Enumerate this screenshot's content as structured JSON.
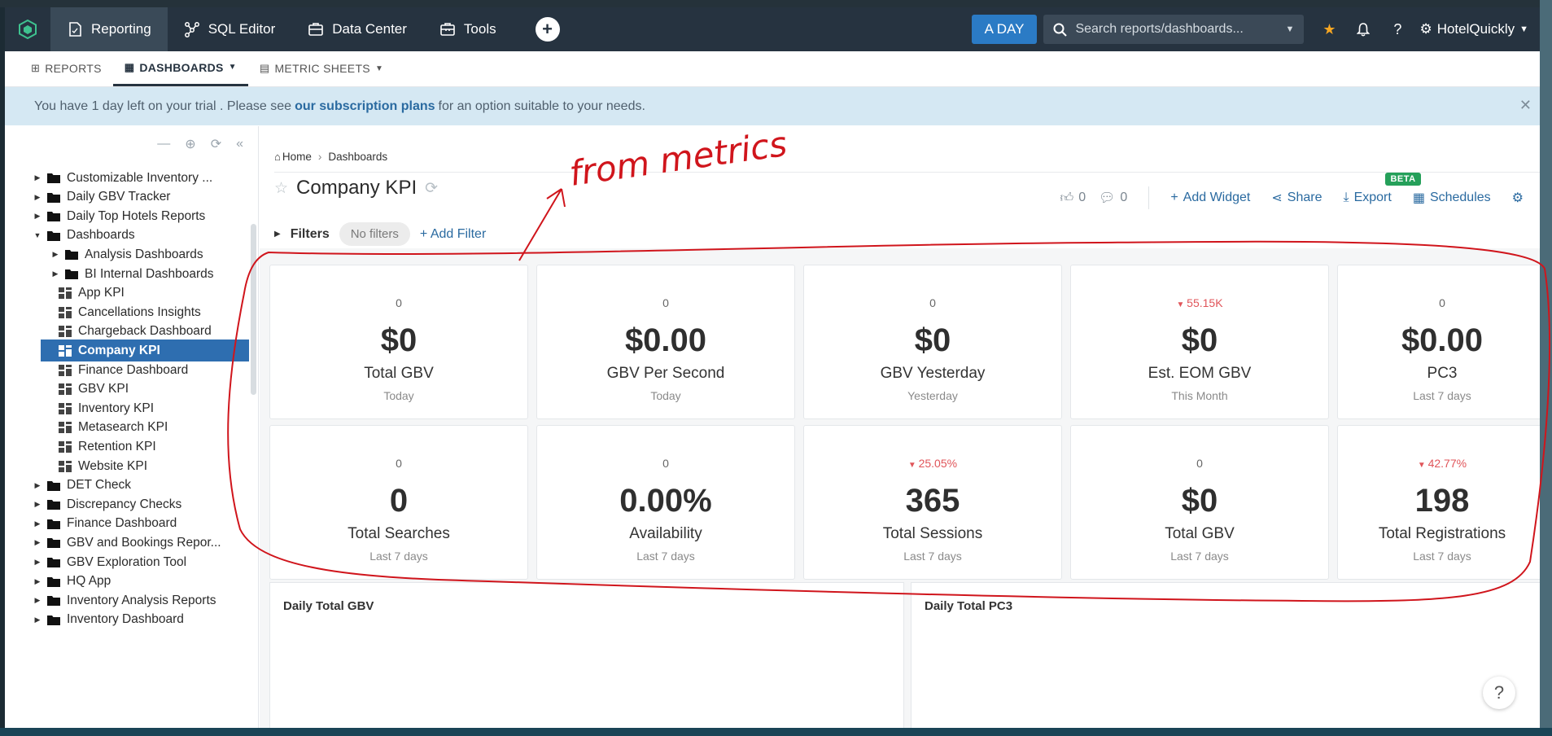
{
  "navbar": {
    "items": [
      {
        "label": "Reporting"
      },
      {
        "label": "SQL Editor"
      },
      {
        "label": "Data Center"
      },
      {
        "label": "Tools"
      }
    ],
    "trial_badge": "A DAY",
    "search_placeholder": "Search reports/dashboards...",
    "user": "HotelQuickly"
  },
  "subnav": {
    "tabs": [
      {
        "label": "REPORTS"
      },
      {
        "label": "DASHBOARDS"
      },
      {
        "label": "METRIC SHEETS"
      }
    ]
  },
  "banner": {
    "prefix": "You have 1 day left on your trial . Please see",
    "link": "our subscription plans",
    "suffix": "for an option suitable to your needs."
  },
  "sidebar": {
    "items": [
      {
        "label": "Customizable Inventory ..."
      },
      {
        "label": "Daily GBV Tracker"
      },
      {
        "label": "Daily Top Hotels Reports"
      },
      {
        "label": "Dashboards"
      },
      {
        "label": "Analysis Dashboards"
      },
      {
        "label": "BI Internal Dashboards"
      },
      {
        "label": "App KPI"
      },
      {
        "label": "Cancellations Insights"
      },
      {
        "label": "Chargeback Dashboard"
      },
      {
        "label": "Company KPI"
      },
      {
        "label": "Finance Dashboard"
      },
      {
        "label": "GBV KPI"
      },
      {
        "label": "Inventory KPI"
      },
      {
        "label": "Metasearch KPI"
      },
      {
        "label": "Retention KPI"
      },
      {
        "label": "Website KPI"
      },
      {
        "label": "DET Check"
      },
      {
        "label": "Discrepancy Checks"
      },
      {
        "label": "Finance Dashboard"
      },
      {
        "label": "GBV and Bookings Repor..."
      },
      {
        "label": "GBV Exploration Tool"
      },
      {
        "label": "HQ App"
      },
      {
        "label": "Inventory Analysis Reports"
      },
      {
        "label": "Inventory Dashboard"
      }
    ]
  },
  "main": {
    "breadcrumb": {
      "home": "Home",
      "current": "Dashboards"
    },
    "title": "Company KPI",
    "likes": "0",
    "comments": "0",
    "actions": {
      "add_widget": "Add Widget",
      "share": "Share",
      "export": "Export",
      "beta": "BETA",
      "schedules": "Schedules"
    },
    "filters": {
      "label": "Filters",
      "none": "No filters",
      "add": "Add Filter"
    },
    "cards": [
      {
        "delta": "0",
        "value": "$0",
        "label": "Total GBV",
        "period": "Today",
        "negative": false
      },
      {
        "delta": "0",
        "value": "$0.00",
        "label": "GBV Per Second",
        "period": "Today",
        "negative": false
      },
      {
        "delta": "0",
        "value": "$0",
        "label": "GBV Yesterday",
        "period": "Yesterday",
        "negative": false
      },
      {
        "delta": "55.15K",
        "value": "$0",
        "label": "Est. EOM GBV",
        "period": "This Month",
        "negative": true
      },
      {
        "delta": "0",
        "value": "$0.00",
        "label": "PC3",
        "period": "Last 7 days",
        "negative": false
      },
      {
        "delta": "0",
        "value": "0",
        "label": "Total Searches",
        "period": "Last 7 days",
        "negative": false
      },
      {
        "delta": "0",
        "value": "0.00%",
        "label": "Availability",
        "period": "Last 7 days",
        "negative": false
      },
      {
        "delta": "25.05%",
        "value": "365",
        "label": "Total Sessions",
        "period": "Last 7 days",
        "negative": true
      },
      {
        "delta": "0",
        "value": "$0",
        "label": "Total GBV",
        "period": "Last 7 days",
        "negative": false
      },
      {
        "delta": "42.77%",
        "value": "198",
        "label": "Total Registrations",
        "period": "Last 7 days",
        "negative": true
      }
    ],
    "panels": [
      {
        "title": "Daily Total GBV"
      },
      {
        "title": "Daily Total PC3"
      }
    ]
  },
  "annotation": {
    "text": "from metrics",
    "color": "#d0151c"
  },
  "colors": {
    "navbar": "#263340",
    "accent": "#2b7bc5",
    "selected": "#2e6eb0",
    "negative": "#e0555a"
  }
}
